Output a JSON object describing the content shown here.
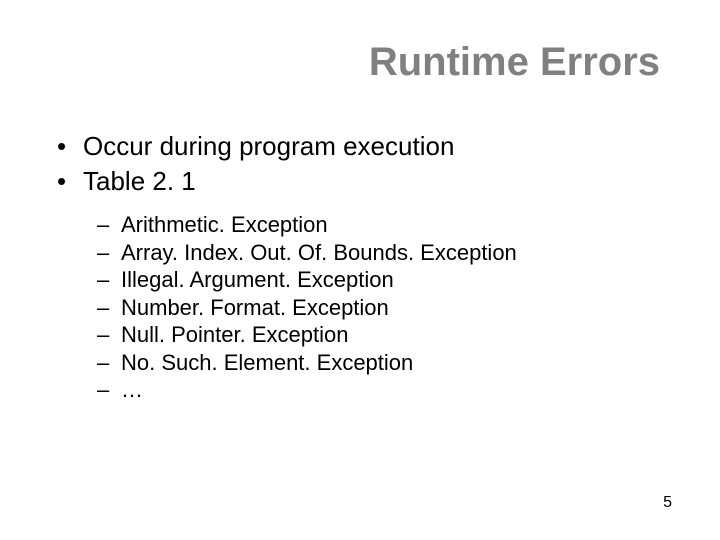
{
  "title": "Runtime Errors",
  "bullets": [
    "Occur during program execution",
    "Table 2. 1"
  ],
  "subbullets": [
    "Arithmetic. Exception",
    "Array. Index. Out. Of. Bounds. Exception",
    "Illegal. Argument. Exception",
    "Number. Format. Exception",
    "Null. Pointer. Exception",
    "No. Such. Element. Exception",
    "…"
  ],
  "page_number": "5"
}
